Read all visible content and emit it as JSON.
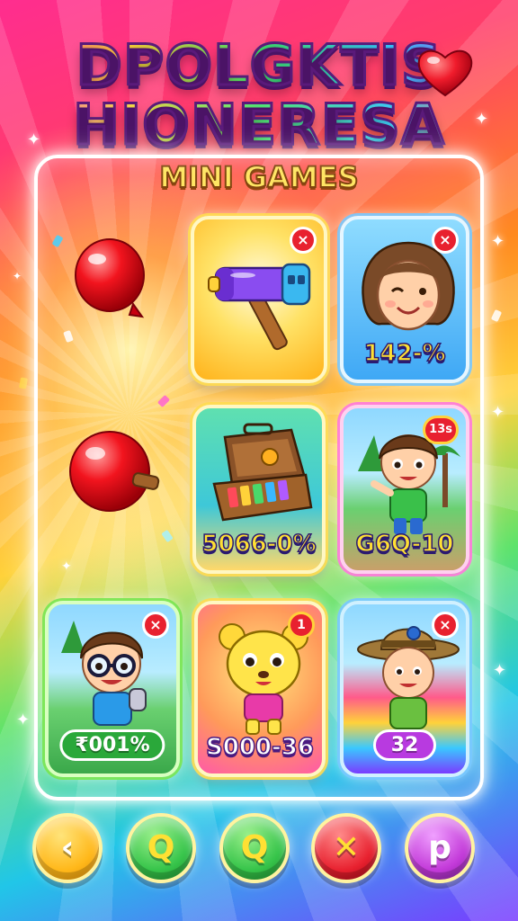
{
  "title": {
    "line1": "DPOLGKTIS",
    "line2": "HIONERESA",
    "subtitle": "MINI GAMES"
  },
  "tiles": {
    "hammer": {
      "icon": "hammer-icon",
      "badge": "×"
    },
    "girl": {
      "icon": "smiling-face-icon",
      "badge": "×",
      "score": "142-%"
    },
    "toolbox": {
      "icon": "toolbox-icon",
      "score": "5066-0%"
    },
    "boy_park": {
      "icon": "boy-character-icon",
      "badge": "13s",
      "score": "G6Q-10"
    },
    "boy_glasses": {
      "icon": "boy-glasses-icon",
      "badge": "×",
      "score": "₹001%"
    },
    "bear": {
      "icon": "bear-character-icon",
      "badge": "1",
      "score": "S000-36"
    },
    "explorer": {
      "icon": "explorer-boy-icon",
      "badge": "×",
      "score": "32"
    }
  },
  "balloons": [
    {
      "icon": "red-balloon-icon"
    },
    {
      "icon": "red-ball-icon"
    }
  ],
  "buttons": [
    {
      "label": "‹",
      "color": "#ffc21a",
      "icon": "back-icon"
    },
    {
      "label": "Q",
      "color": "#36c44a",
      "icon": "search-icon"
    },
    {
      "label": "Q",
      "color": "#36c44a",
      "icon": "search-icon"
    },
    {
      "label": "✕",
      "color": "#e8212f",
      "icon": "close-icon"
    },
    {
      "label": "p",
      "color": "#c33ad9",
      "icon": "profile-icon"
    }
  ],
  "colors": {
    "badge_red": "#e8212f",
    "score_yellow": "#ffe033"
  }
}
